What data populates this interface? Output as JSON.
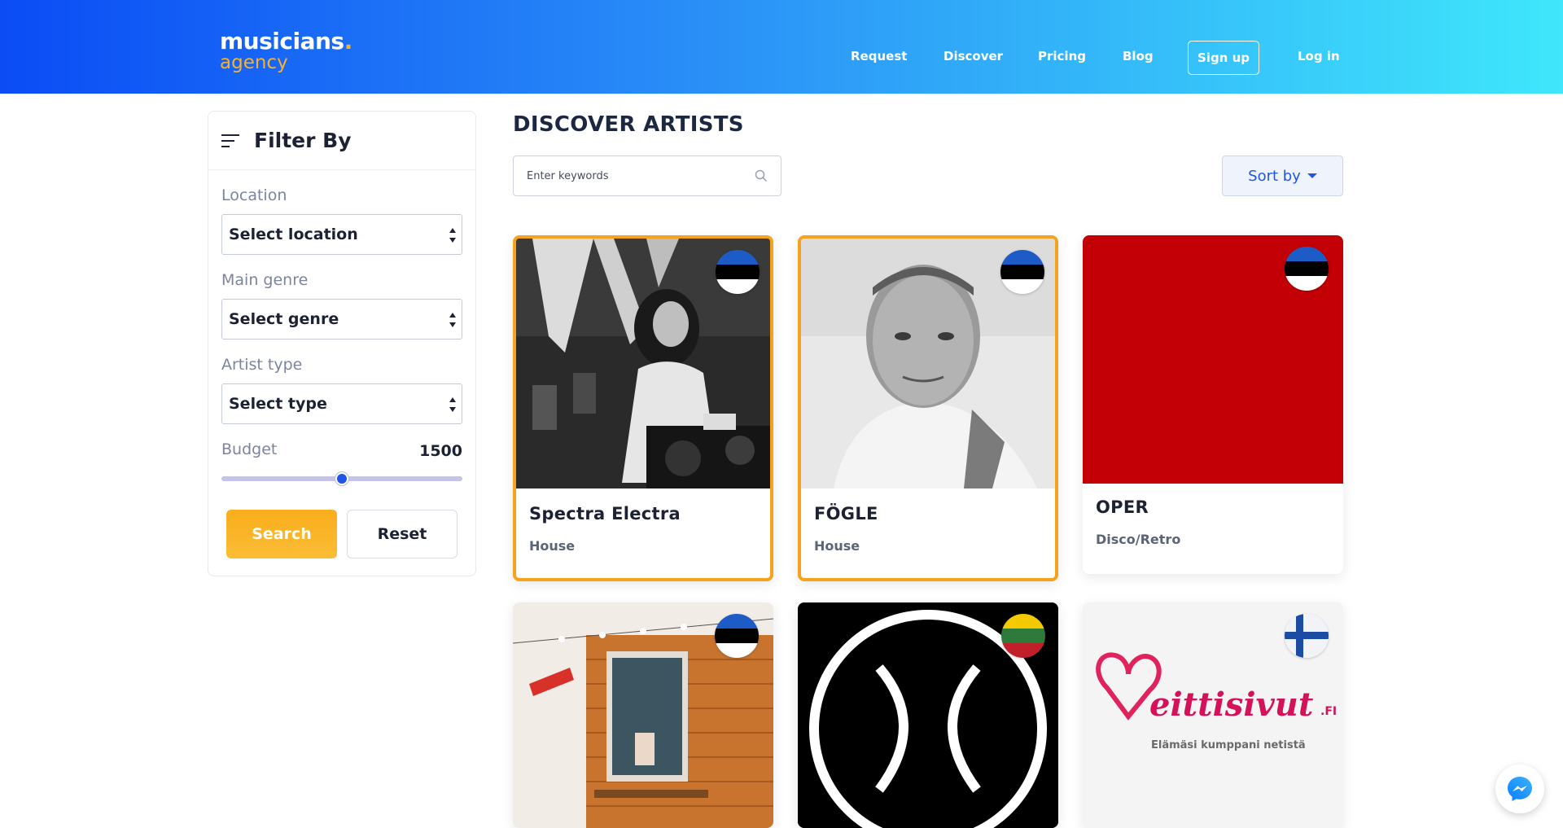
{
  "header": {
    "logo_main": "musicians",
    "logo_dot": ".",
    "logo_sub": "agency",
    "nav": [
      "Request",
      "Discover",
      "Pricing",
      "Blog"
    ],
    "signup": "Sign up",
    "login": "Log in"
  },
  "filter": {
    "title": "Filter By",
    "location_label": "Location",
    "location_value": "Select location",
    "genre_label": "Main genre",
    "genre_value": "Select genre",
    "type_label": "Artist type",
    "type_value": "Select type",
    "budget_label": "Budget",
    "budget_value": "1500",
    "budget_fraction": 0.5,
    "search_button": "Search",
    "reset_button": "Reset"
  },
  "main": {
    "title": "DISCOVER ARTISTS",
    "search_placeholder": "Enter keywords",
    "sort_label": "Sort by"
  },
  "artists": [
    {
      "name": "Spectra Electra",
      "genre": "House",
      "flag": "estonia-flag",
      "featured": true
    },
    {
      "name": "FÖGLE",
      "genre": "House",
      "flag": "estonia-flag",
      "featured": true
    },
    {
      "name": "OPER",
      "genre": "Disco/Retro",
      "flag": "estonia-flag",
      "featured": false
    },
    {
      "name": "",
      "genre": "",
      "flag": "estonia-flag",
      "featured": false
    },
    {
      "name": "",
      "genre": "",
      "flag": "lithuania-flag",
      "featured": false
    },
    {
      "name": "",
      "genre": "",
      "flag": "finland-flag",
      "featured": false
    }
  ],
  "ad_card": {
    "brand": "eittisivut",
    "brand_suffix": ".FI",
    "tagline": "Elämäsi kumppani netistä"
  },
  "colors": {
    "accent_orange": "#f6a21e",
    "accent_blue": "#1f56e8",
    "header_gradient_start": "#0b4cf5",
    "header_gradient_end": "#3fe7fb"
  }
}
